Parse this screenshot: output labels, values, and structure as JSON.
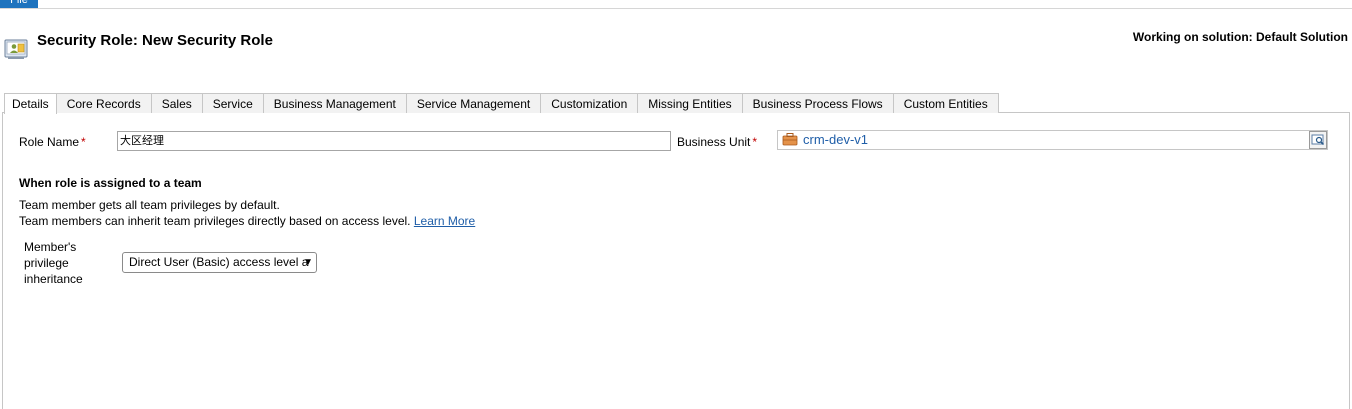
{
  "file_tab": {
    "label": "File"
  },
  "header": {
    "title": "Security Role: New Security Role",
    "solution_label": "Working on solution: Default Solution"
  },
  "tabs": [
    {
      "label": "Details",
      "active": true
    },
    {
      "label": "Core Records"
    },
    {
      "label": "Sales"
    },
    {
      "label": "Service"
    },
    {
      "label": "Business Management"
    },
    {
      "label": "Service Management"
    },
    {
      "label": "Customization"
    },
    {
      "label": "Missing Entities"
    },
    {
      "label": "Business Process Flows"
    },
    {
      "label": "Custom Entities"
    }
  ],
  "form": {
    "role_name_label": "Role Name",
    "role_name_value": "大区经理",
    "required_marker": "*",
    "business_unit_label": "Business Unit",
    "business_unit_value": "crm-dev-v1"
  },
  "team_section": {
    "heading": "When role is assigned to a team",
    "line1": "Team member gets all team privileges by default.",
    "line2": "Team members can inherit team privileges directly based on access level.",
    "learn_more": "Learn More",
    "member_label": "Member's privilege inheritance",
    "select_value": "Direct User (Basic) access level a"
  },
  "colors": {
    "accent": "#1e73be",
    "link": "#1f5ea8",
    "required": "#c00000"
  }
}
